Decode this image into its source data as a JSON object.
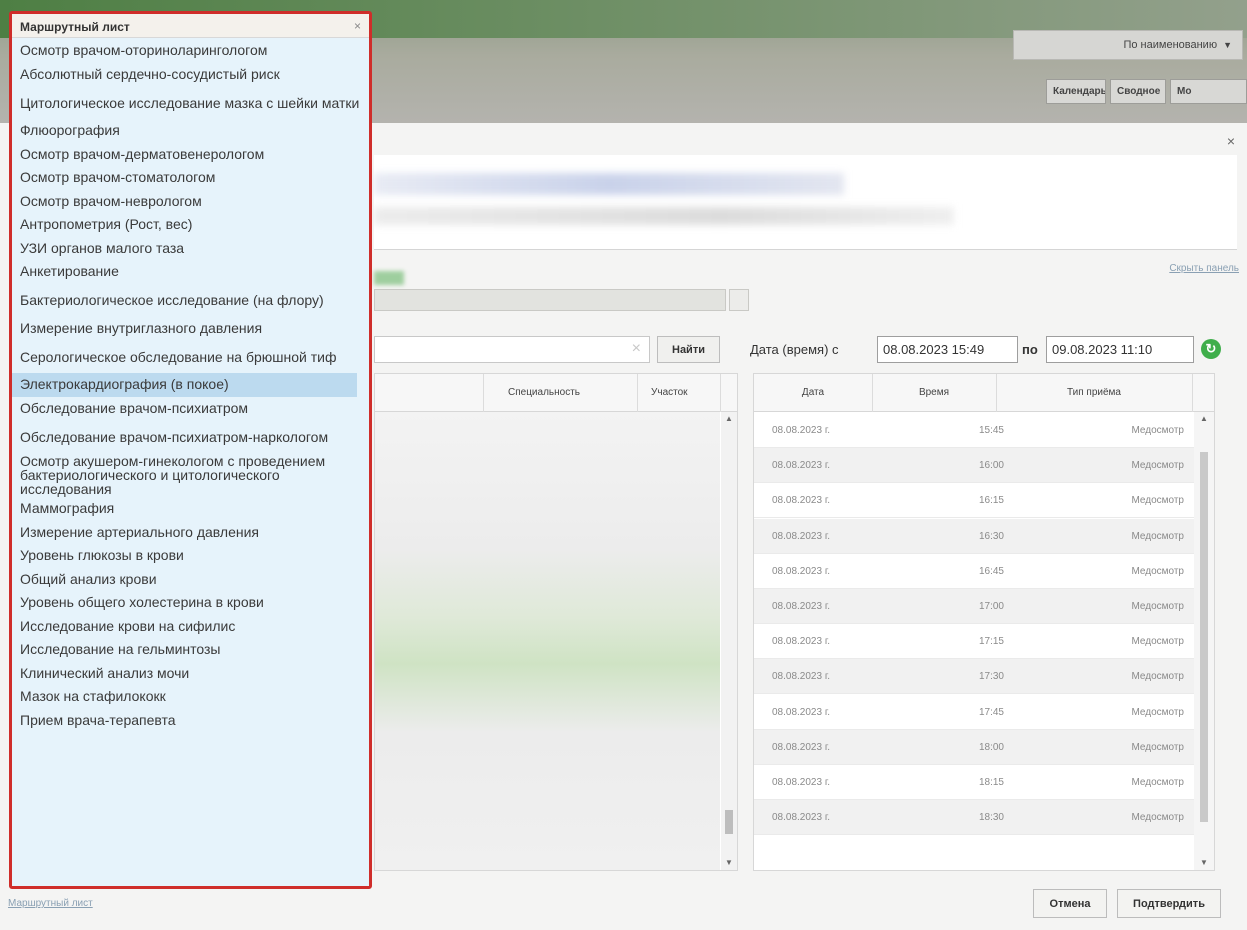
{
  "top": {
    "sort_select": "По наименованию",
    "tab_calendar": "Календарь",
    "tab_summary": "Сводное",
    "tab_more": "Мо"
  },
  "dialog": {
    "close": "×",
    "hide_panel": "Скрыть панель",
    "search_clear": "×",
    "find_button": "Найти",
    "date_label": "Дата (время) с",
    "date_from": "08.08.2023 15:49",
    "date_to_label": "по",
    "date_to": "09.08.2023 11:10",
    "refresh": "↻",
    "left_table": {
      "col_specialty": "Специальность",
      "col_district": "Участок"
    },
    "schedule": {
      "col_date": "Дата",
      "col_time": "Время",
      "col_type": "Тип приёма",
      "rows": [
        {
          "date": "08.08.2023 г.",
          "time": "15:45",
          "type": "Медосмотр"
        },
        {
          "date": "08.08.2023 г.",
          "time": "16:00",
          "type": "Медосмотр"
        },
        {
          "date": "08.08.2023 г.",
          "time": "16:15",
          "type": "Медосмотр"
        },
        {
          "date": "08.08.2023 г.",
          "time": "16:30",
          "type": "Медосмотр"
        },
        {
          "date": "08.08.2023 г.",
          "time": "16:45",
          "type": "Медосмотр"
        },
        {
          "date": "08.08.2023 г.",
          "time": "17:00",
          "type": "Медосмотр"
        },
        {
          "date": "08.08.2023 г.",
          "time": "17:15",
          "type": "Медосмотр"
        },
        {
          "date": "08.08.2023 г.",
          "time": "17:30",
          "type": "Медосмотр"
        },
        {
          "date": "08.08.2023 г.",
          "time": "17:45",
          "type": "Медосмотр"
        },
        {
          "date": "08.08.2023 г.",
          "time": "18:00",
          "type": "Медосмотр"
        },
        {
          "date": "08.08.2023 г.",
          "time": "18:15",
          "type": "Медосмотр"
        },
        {
          "date": "08.08.2023 г.",
          "time": "18:30",
          "type": "Медосмотр"
        }
      ]
    },
    "footer_link": "Маршрутный лист",
    "cancel_button": "Отмена",
    "confirm_button": "Подтвердить"
  },
  "route_sheet": {
    "title": "Маршрутный лист",
    "close": "×",
    "selected_item": "Электрокардиография (в покое)",
    "items": [
      "Осмотр врачом-оториноларингологом",
      "Абсолютный сердечно-сосудистый риск",
      "Цитологическое исследование мазка с шейки матки",
      "Флюорография",
      "Осмотр врачом-дерматовенерологом",
      "Осмотр врачом-стоматологом",
      "Осмотр врачом-неврологом",
      "Антропометрия (Рост, вес)",
      "УЗИ органов малого таза",
      "Анкетирование",
      "Бактериологическое исследование (на флору)",
      "Измерение внутриглазного давления",
      "Серологическое обследование на брюшной тиф",
      "Электрокардиография (в покое)",
      "Обследование врачом-психиатром",
      "Обследование врачом-психиатром-наркологом",
      "Осмотр акушером-гинекологом с проведением бактериологического и цитологического исследования",
      "Маммография",
      "Измерение артериального давления",
      "Уровень глюкозы в крови",
      "Общий анализ крови",
      "Уровень общего холестерина в крови",
      "Исследование крови на сифилис",
      "Исследование на гельминтозы",
      "Клинический анализ мочи",
      "Мазок на стафилококк",
      "Прием врача-терапевта"
    ]
  }
}
